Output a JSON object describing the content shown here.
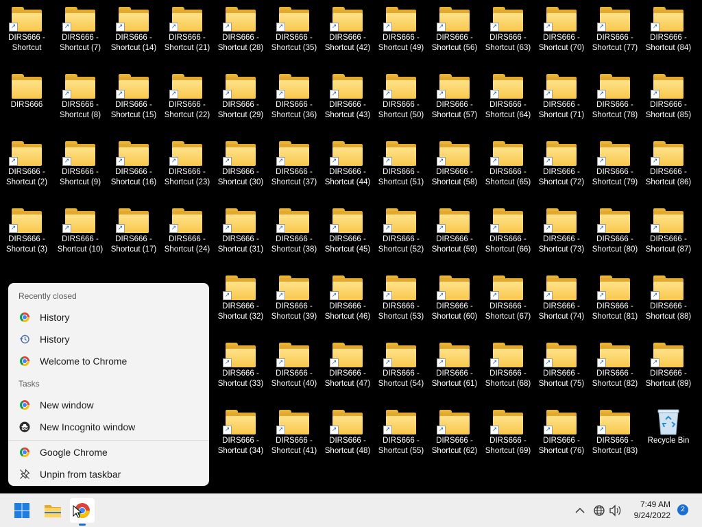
{
  "desktop": {
    "columns": [
      [
        "DIRS666 - Shortcut",
        "DIRS666",
        "DIRS666 - Shortcut (2)",
        "DIRS666 - Shortcut (3)"
      ],
      [
        "DIRS666 - Shortcut (7)",
        "DIRS666 - Shortcut (8)",
        "DIRS666 - Shortcut (9)",
        "DIRS666 - Shortcut (10)"
      ],
      [
        "DIRS666 - Shortcut (14)",
        "DIRS666 - Shortcut (15)",
        "DIRS666 - Shortcut (16)",
        "DIRS666 - Shortcut (17)"
      ],
      [
        "DIRS666 - Shortcut (21)",
        "DIRS666 - Shortcut (22)",
        "DIRS666 - Shortcut (23)",
        "DIRS666 - Shortcut (24)"
      ],
      [
        "DIRS666 - Shortcut (28)",
        "DIRS666 - Shortcut (29)",
        "DIRS666 - Shortcut (30)",
        "DIRS666 - Shortcut (31)",
        "DIRS666 - Shortcut (32)",
        "DIRS666 - Shortcut (33)",
        "DIRS666 - Shortcut (34)"
      ],
      [
        "DIRS666 - Shortcut (35)",
        "DIRS666 - Shortcut (36)",
        "DIRS666 - Shortcut (37)",
        "DIRS666 - Shortcut (38)",
        "DIRS666 - Shortcut (39)",
        "DIRS666 - Shortcut (40)",
        "DIRS666 - Shortcut (41)"
      ],
      [
        "DIRS666 - Shortcut (42)",
        "DIRS666 - Shortcut (43)",
        "DIRS666 - Shortcut (44)",
        "DIRS666 - Shortcut (45)",
        "DIRS666 - Shortcut (46)",
        "DIRS666 - Shortcut (47)",
        "DIRS666 - Shortcut (48)"
      ],
      [
        "DIRS666 - Shortcut (49)",
        "DIRS666 - Shortcut (50)",
        "DIRS666 - Shortcut (51)",
        "DIRS666 - Shortcut (52)",
        "DIRS666 - Shortcut (53)",
        "DIRS666 - Shortcut (54)",
        "DIRS666 - Shortcut (55)"
      ],
      [
        "DIRS666 - Shortcut (56)",
        "DIRS666 - Shortcut (57)",
        "DIRS666 - Shortcut (58)",
        "DIRS666 - Shortcut (59)",
        "DIRS666 - Shortcut (60)",
        "DIRS666 - Shortcut (61)",
        "DIRS666 - Shortcut (62)"
      ],
      [
        "DIRS666 - Shortcut (63)",
        "DIRS666 - Shortcut (64)",
        "DIRS666 - Shortcut (65)",
        "DIRS666 - Shortcut (66)",
        "DIRS666 - Shortcut (67)",
        "DIRS666 - Shortcut (68)",
        "DIRS666 - Shortcut (69)"
      ],
      [
        "DIRS666 - Shortcut (70)",
        "DIRS666 - Shortcut (71)",
        "DIRS666 - Shortcut (72)",
        "DIRS666 - Shortcut (73)",
        "DIRS666 - Shortcut (74)",
        "DIRS666 - Shortcut (75)",
        "DIRS666 - Shortcut (76)"
      ],
      [
        "DIRS666 - Shortcut (77)",
        "DIRS666 - Shortcut (78)",
        "DIRS666 - Shortcut (79)",
        "DIRS666 - Shortcut (80)",
        "DIRS666 - Shortcut (81)",
        "DIRS666 - Shortcut (82)",
        "DIRS666 - Shortcut (83)"
      ],
      [
        "DIRS666 - Shortcut (84)",
        "DIRS666 - Shortcut (85)",
        "DIRS666 - Shortcut (86)",
        "DIRS666 - Shortcut (87)",
        "DIRS666 - Shortcut (88)",
        "DIRS666 - Shortcut (89)",
        "Recycle Bin"
      ]
    ],
    "non_shortcut_labels": [
      "DIRS666",
      "Recycle Bin"
    ]
  },
  "jumplist": {
    "recently_closed_header": "Recently closed",
    "recent": [
      {
        "label": "History",
        "icon": "chrome-icon"
      },
      {
        "label": "History",
        "icon": "history-icon"
      },
      {
        "label": "Welcome to Chrome",
        "icon": "chrome-icon"
      }
    ],
    "tasks_header": "Tasks",
    "tasks": [
      {
        "label": "New window",
        "icon": "chrome-icon"
      },
      {
        "label": "New Incognito window",
        "icon": "incognito-icon"
      }
    ],
    "app_label": "Google Chrome",
    "unpin_label": "Unpin from taskbar"
  },
  "taskbar": {
    "time": "7:49 AM",
    "date": "9/24/2022",
    "notification_count": "2",
    "accent_color": "#1a6fd1"
  }
}
